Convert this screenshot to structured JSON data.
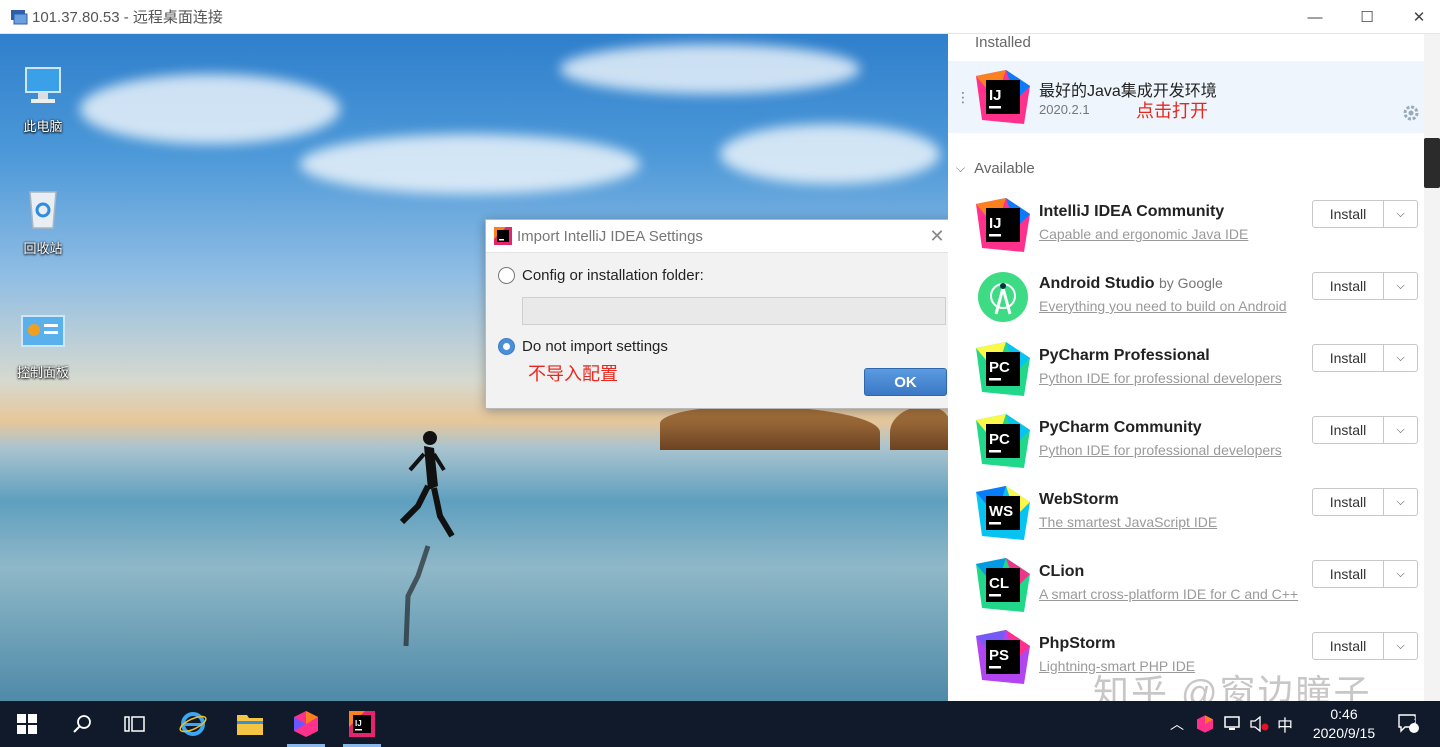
{
  "window": {
    "title": "101.37.80.53 - 远程桌面连接",
    "minimize": "—",
    "maximize": "☐",
    "close": "✕"
  },
  "desktop_icons": [
    {
      "label": "此电脑",
      "icon": "computer-icon"
    },
    {
      "label": "回收站",
      "icon": "recycle-bin-icon"
    },
    {
      "label": "控制面板",
      "icon": "control-panel-icon"
    }
  ],
  "dialog": {
    "title": "Import IntelliJ IDEA Settings",
    "option1": "Config or installation folder:",
    "path_value": "",
    "option2": "Do not import settings",
    "selected": "option2",
    "note": "不导入配置",
    "ok": "OK"
  },
  "toolbox": {
    "installed_header": "Installed",
    "installed": {
      "name": "最好的Java集成开发环境",
      "version": "2020.2.1",
      "note": "点击打开"
    },
    "available_header": "Available",
    "install_label": "Install",
    "apps": [
      {
        "logo": "IJ",
        "name": "IntelliJ IDEA Community",
        "by": "",
        "desc": "Capable and ergonomic Java IDE"
      },
      {
        "logo": "AS",
        "name": "Android Studio",
        "by": "by Google",
        "desc": "Everything you need to build on Android"
      },
      {
        "logo": "PC",
        "name": "PyCharm Professional",
        "by": "",
        "desc": "Python IDE for professional developers"
      },
      {
        "logo": "PC",
        "name": "PyCharm Community",
        "by": "",
        "desc": "Python IDE for professional developers"
      },
      {
        "logo": "WS",
        "name": "WebStorm",
        "by": "",
        "desc": "The smartest JavaScript IDE"
      },
      {
        "logo": "CL",
        "name": "CLion",
        "by": "",
        "desc": "A smart cross-platform IDE for C and C++"
      },
      {
        "logo": "PS",
        "name": "PhpStorm",
        "by": "",
        "desc": "Lightning-smart PHP IDE"
      }
    ]
  },
  "watermark": "知乎 @窗边瞳子",
  "taskbar": {
    "ime": "中",
    "time": "0:46",
    "date": "2020/9/15",
    "notifications": "3"
  },
  "colors": {
    "accent": "#4a8fd8",
    "note_red": "#e8281e",
    "taskbar": "#101a2a"
  }
}
